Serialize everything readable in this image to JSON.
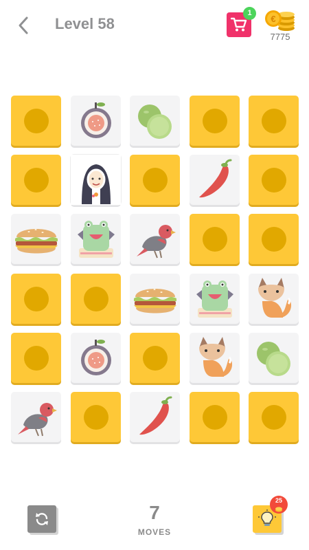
{
  "header": {
    "title": "Level 58",
    "cart_badge": "1",
    "coins": "7775"
  },
  "colors": {
    "tile_closed": "#fec837",
    "tile_dot": "#e1a800",
    "cart": "#f0326a",
    "badge_green": "#4cd45b",
    "hint_badge": "#f24a3a"
  },
  "board": {
    "rows": [
      [
        "closed",
        "fig",
        "lime",
        "closed",
        "closed"
      ],
      [
        "closed",
        "nun",
        "closed",
        "chili",
        "closed"
      ],
      [
        "burger",
        "monster",
        "bird",
        "closed",
        "closed"
      ],
      [
        "closed",
        "closed",
        "burger",
        "monster",
        "fox"
      ],
      [
        "closed",
        "fig",
        "closed",
        "fox",
        "lime"
      ],
      [
        "bird",
        "closed",
        "chili",
        "closed",
        "closed"
      ]
    ]
  },
  "footer": {
    "moves": "7",
    "moves_label": "MOVES",
    "hint_badge": "25"
  }
}
